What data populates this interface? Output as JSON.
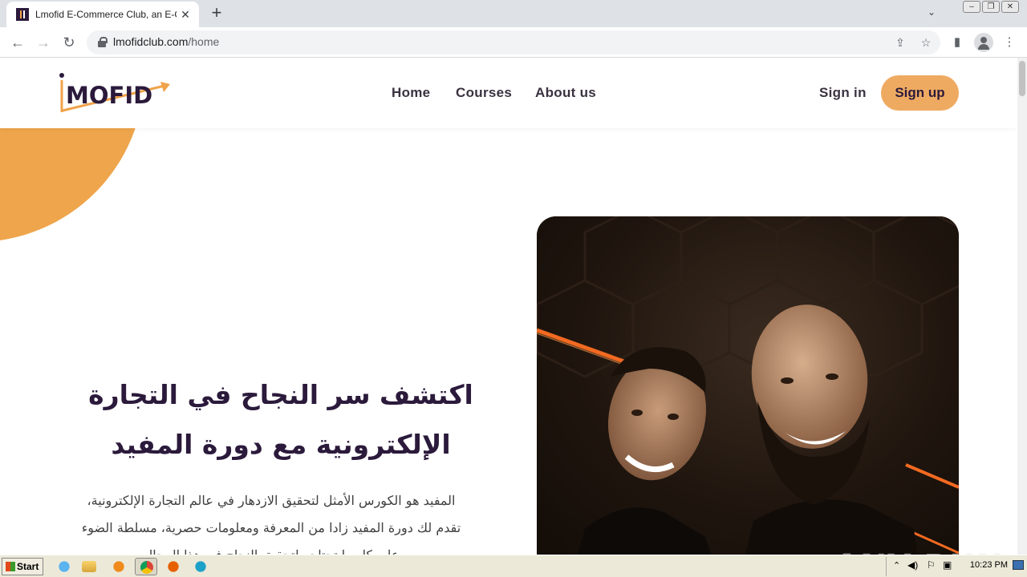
{
  "browser": {
    "tab_title": "Lmofid E-Commerce Club, an E-Comm",
    "new_tab_symbol": "+",
    "url_host": "lmofidclub.com",
    "url_path": "/home"
  },
  "site": {
    "logo_text": "MOFID",
    "nav": [
      "Home",
      "Courses",
      "About us"
    ],
    "sign_in": "Sign in",
    "sign_up": "Sign up"
  },
  "hero": {
    "title_line1": "اكتشف سر النجاح في التجارة",
    "title_line2": "الإلكترونية مع دورة المفيد",
    "body_line1": "المفيد هو الكورس الأمثل لتحقيق الازدهار في عالم التجارة الإلكترونية،",
    "body_line2": "تقدم لك دورة المفيد زادا من المعرفة ومعلومات حصرية، مسلطة الضوء",
    "body_line3": "على كل ما تحتاجه لتحقيق النجاح في هذا المجال"
  },
  "watermark": "ANY RUN",
  "taskbar": {
    "start_label": "Start",
    "clock": "10:23 PM"
  },
  "colors": {
    "brand_dark": "#2b1a3b",
    "accent_orange": "#efaa62",
    "blob_orange": "#eea54b"
  }
}
